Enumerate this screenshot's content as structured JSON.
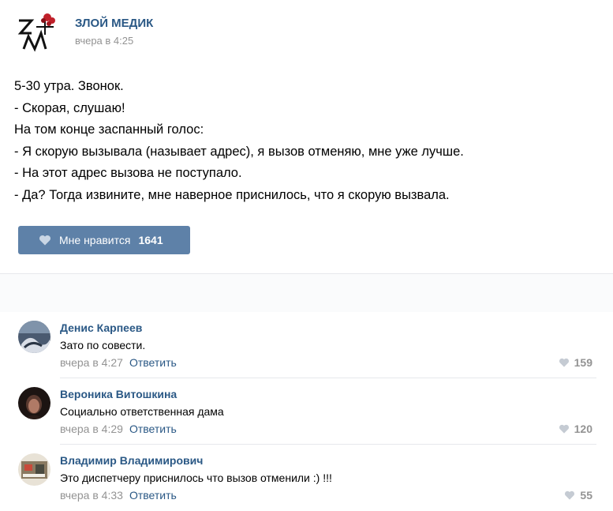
{
  "post": {
    "author": "ЗЛОЙ МЕДИК",
    "time": "вчера в 4:25",
    "lines": [
      "5-30 утра. Звонок.",
      "- Скорая, слушаю!",
      "На том конце заспанный голос:",
      "- Я скорую вызывала (называет адрес), я вызов отменяю, мне уже лучше.",
      "- На этот адрес вызова не поступало.",
      "- Да? Тогда извините, мне наверное приснилось, что я скорую вызвала."
    ],
    "like_label": "Мне нравится",
    "like_count": "1641",
    "logo_icon": "zm-logo-icon"
  },
  "comments": [
    {
      "name": "Денис Карпеев",
      "text": "Зато по совести.",
      "time": "вчера в 4:27",
      "reply": "Ответить",
      "likes": "159"
    },
    {
      "name": "Вероника Витошкина",
      "text": "Социально ответственная дама",
      "time": "вчера в 4:29",
      "reply": "Ответить",
      "likes": "120"
    },
    {
      "name": "Владимир Владимирович",
      "text": "Это диспетчеру приснилось что вызов отменили :) !!!",
      "time": "вчера в 4:33",
      "reply": "Ответить",
      "likes": "55"
    }
  ],
  "colors": {
    "link": "#2a5885",
    "like_button": "#5e81a8",
    "muted": "#939393"
  }
}
